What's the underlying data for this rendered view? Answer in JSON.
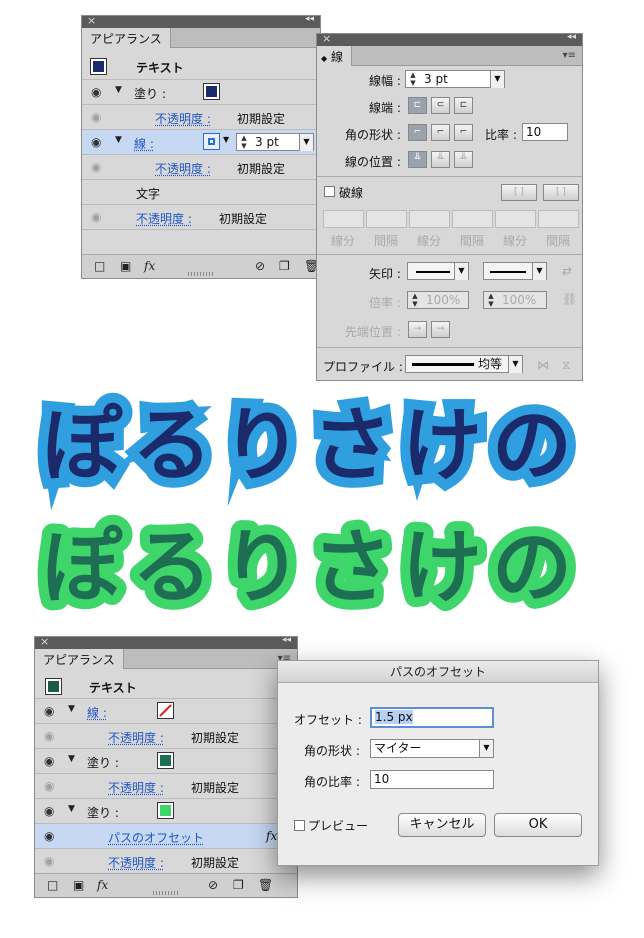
{
  "appearance_panel_top": {
    "tab": "アピアランス",
    "header": "テキスト",
    "header_color": "#1b2a6b",
    "rows": [
      {
        "label": "塗り :",
        "swatch": "#1b2a6b"
      },
      {
        "label": "不透明度 :",
        "value": "初期設定"
      },
      {
        "label": "線 :",
        "stroke_value": "3 pt"
      },
      {
        "label": "不透明度 :",
        "value": "初期設定"
      },
      {
        "label": "文字"
      },
      {
        "label": "不透明度 :",
        "value": "初期設定"
      }
    ],
    "footer_fx": "fx"
  },
  "stroke_panel": {
    "tab": "線",
    "weight_label": "線幅 :",
    "weight_value": "3 pt",
    "cap_label": "線端 :",
    "corner_label": "角の形状 :",
    "ratio_label": "比率 :",
    "ratio_value": "10",
    "align_label": "線の位置 :",
    "dashed_label": "破線",
    "dash_labels": [
      "線分",
      "間隔",
      "線分",
      "間隔",
      "線分",
      "間隔"
    ],
    "arrow_label": "矢印 :",
    "scale_label": "倍率 :",
    "scale_value_1": "100%",
    "scale_value_2": "100%",
    "tip_label": "先端位置 :",
    "profile_label": "プロファイル :",
    "profile_value": "均等"
  },
  "sample_text": {
    "line1": "ぽるりさけの",
    "line2": "ぽるりさけの",
    "line1_fill": "#1b2a6b",
    "line1_stroke": "#2f9fe0",
    "line2_fill": "#1d6e52",
    "line2_stroke": "#3ed66a"
  },
  "appearance_panel_bottom": {
    "tab": "アピアランス",
    "header": "テキスト",
    "header_color": "#1d5a48",
    "rows": [
      {
        "label": "線 :"
      },
      {
        "label": "不透明度 :",
        "value": "初期設定"
      },
      {
        "label": "塗り :",
        "swatch": "#1d6e52"
      },
      {
        "label": "不透明度 :",
        "value": "初期設定"
      },
      {
        "label": "塗り :",
        "swatch": "#3ed66a"
      },
      {
        "label": "パスのオフセット"
      },
      {
        "label": "不透明度 :",
        "value": "初期設定"
      }
    ],
    "footer_fx": "fx"
  },
  "offset_dialog": {
    "title": "パスのオフセット",
    "offset_label": "オフセット :",
    "offset_value": "1.5 px",
    "joins_label": "角の形状 :",
    "joins_value": "マイター",
    "miter_label": "角の比率 :",
    "miter_value": "10",
    "preview_label": "プレビュー",
    "cancel_label": "キャンセル",
    "ok_label": "OK"
  }
}
